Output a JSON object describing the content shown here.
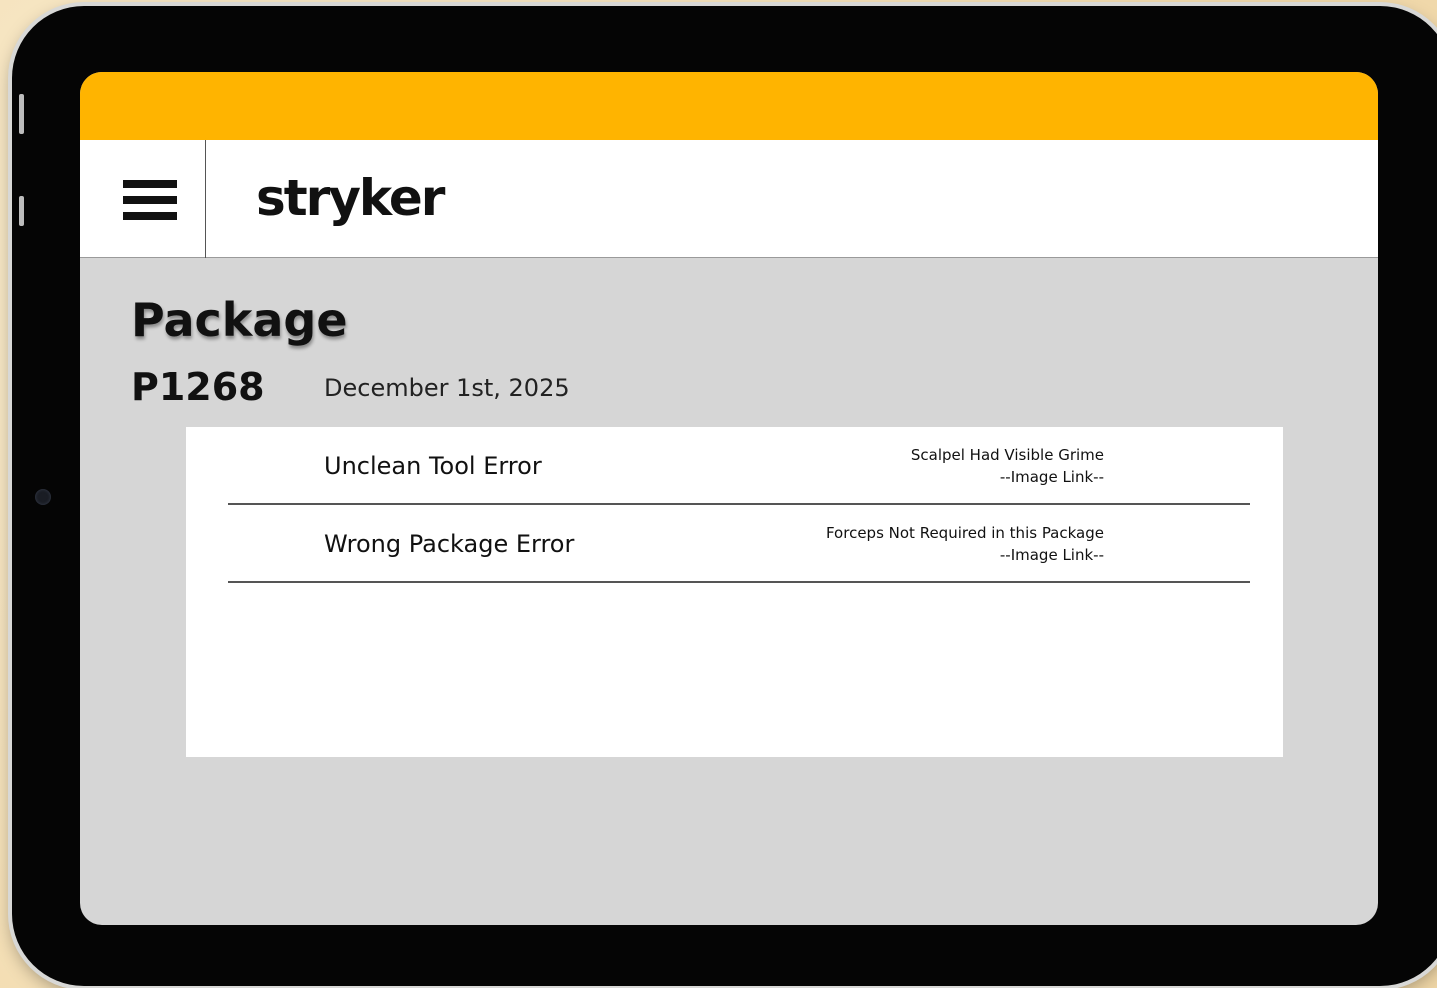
{
  "header": {
    "logo_text": "stryker",
    "topbar_color": "#FFB400"
  },
  "page": {
    "title": "Package",
    "package_id": "P1268",
    "date": "December 1st, 2025"
  },
  "errors": [
    {
      "title": "Unclean Tool Error",
      "description": "Scalpel Had Visible Grime",
      "link_label": "--Image Link--"
    },
    {
      "title": "Wrong Package Error",
      "description": "Forceps Not Required in this Package",
      "link_label": "--Image Link--"
    }
  ]
}
